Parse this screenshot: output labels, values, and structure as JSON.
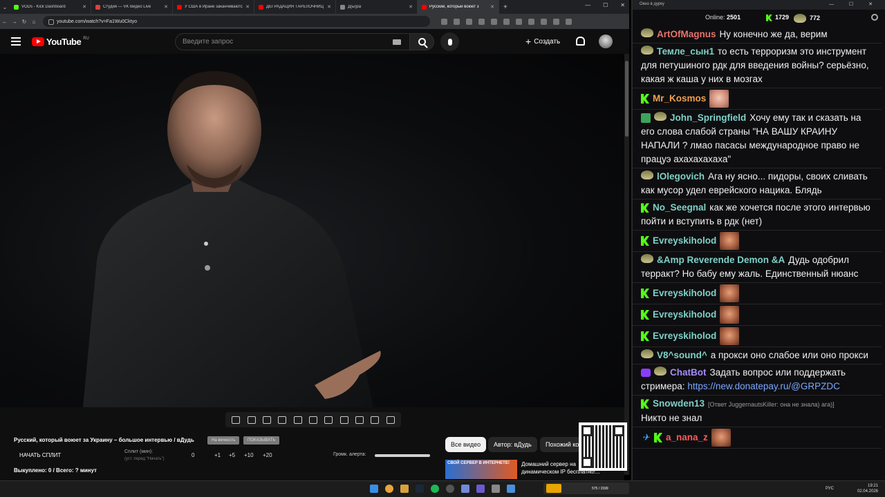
{
  "browser": {
    "tabs": [
      {
        "label": "VODs - Kick Dashboard",
        "color": "#53fc18",
        "active": false
      },
      {
        "label": "Студия — VK Видео Live",
        "color": "#e04040",
        "active": false
      },
      {
        "label": "У США в Иране заканчиваются",
        "color": "#ff0000",
        "active": false
      },
      {
        "label": "ДЕГРАДАЦИЯ ТАРЕЛОЧНИЦ",
        "color": "#ff0000",
        "active": false
      },
      {
        "label": "Д(ы)ра",
        "color": "#888888",
        "active": false
      },
      {
        "label": "Русский, который воюет з",
        "color": "#ff0000",
        "active": true
      }
    ],
    "url": "youtube.com/watch?v=Fa1Wu0Cktyo"
  },
  "youtube": {
    "logo_text": "YouTube",
    "country": "RU",
    "search_placeholder": "Введите запрос",
    "create_label": "Создать"
  },
  "video": {
    "title": "Русский, который воюет за Украину – большое интервью / вДудь",
    "pill1": "На вечность",
    "pill2": "ПОКАЗЫВАТЬ"
  },
  "split": {
    "start_label": "НАЧАТЬ СПЛИТ",
    "label": "Сплит (мин):",
    "hint": "(уст. перед \"Начать\")",
    "values": [
      "0",
      "+1",
      "+5",
      "+10",
      "+20"
    ],
    "stats": "Выкуплено: 0 / Всего: ? минут",
    "alert_label": "Громк. алерта:"
  },
  "chips": [
    "Все видео",
    "Автор: вДудь",
    "Похожий ко"
  ],
  "ad": {
    "banner": "СВОЙ СЕРВЕР В ИНТЕРНЕТЕ!",
    "text": "Домашний сервер на динамическом IP бесплатно!..."
  },
  "chat": {
    "window_title": "Окно в дурку",
    "online_label": "Online:",
    "online_count": "2501",
    "kick_count": "1729",
    "other_count": "772",
    "messages": [
      {
        "user": "ArtOfMagnus",
        "color": "#e8736b",
        "badges": [
          "cow"
        ],
        "text": "Ну конечно же да, верим"
      },
      {
        "user": "Темле_сын1",
        "color": "#7fd1c8",
        "badges": [
          "cow"
        ],
        "text": "то есть терроризм это инструмент для петушиного рдк для введения войны? серьёзно, какая ж каша у них в мозгах"
      },
      {
        "user": "Mr_Kosmos",
        "color": "#f0a050",
        "badges": [
          "kick"
        ],
        "text": "",
        "emote": "pale"
      },
      {
        "user": "John_Springfield",
        "color": "#7fd1c8",
        "badges": [
          "green",
          "cow"
        ],
        "text": "Хочу ему так и сказать на его слова слабой страны \"НА ВАШУ КРАИНУ НАПАЛИ ? лмао пасасы международное право не працуэ ахахахахаха\""
      },
      {
        "user": "lOlegovich",
        "color": "#7fd1c8",
        "badges": [
          "cow"
        ],
        "text": "Ага ну ясно... пидоры, своих сливать как мусор удел еврейского нацика. Блядь"
      },
      {
        "user": "No_Seegnal",
        "color": "#7fd1c8",
        "badges": [
          "kick"
        ],
        "text": "как же хочется после этого интервью пойти и вступить в рдк (нет)"
      },
      {
        "user": "Evreyskiholod",
        "color": "#7fd1c8",
        "badges": [
          "kick"
        ],
        "text": "",
        "emote": "dark"
      },
      {
        "user": "&Amp Reverende Demon &A",
        "color": "#7fd1c8",
        "badges": [
          "cow"
        ],
        "text": "Дудь одобрил терракт? Но бабу ему жаль. Единственный нюанс"
      },
      {
        "user": "Evreyskiholod",
        "color": "#7fd1c8",
        "badges": [
          "kick"
        ],
        "text": "",
        "emote": "dark"
      },
      {
        "user": "Evreyskiholod",
        "color": "#7fd1c8",
        "badges": [
          "kick"
        ],
        "text": "",
        "emote": "dark"
      },
      {
        "user": "Evreyskiholod",
        "color": "#7fd1c8",
        "badges": [
          "kick"
        ],
        "text": "",
        "emote": "dark"
      },
      {
        "user": "V8^sound^",
        "color": "#7fd1c8",
        "badges": [
          "cow"
        ],
        "text": "а прокси оно слабое или оно прокси"
      },
      {
        "user": "ChatBot",
        "color": "#a78bfa",
        "badges": [
          "purple",
          "cow"
        ],
        "text": "Задать вопрос или поддержать стримера:",
        "link": "https://new.donatepay.ru/@GRPZDC"
      },
      {
        "user": "Snowden13",
        "color": "#7fd1c8",
        "badges": [
          "kick"
        ],
        "reply": "[Ответ JuggernautsKiller: она не знала) ага)]",
        "text": "Никто не знал"
      },
      {
        "user": "a_nana_z",
        "color": "#ff5a5a",
        "badges": [
          "blue",
          "kick"
        ],
        "text": "",
        "emote": "dark"
      }
    ]
  },
  "taskbar": {
    "lang": "РУС",
    "time": "19:21",
    "date": "02.04.2026",
    "promo": "575 / 1599"
  }
}
